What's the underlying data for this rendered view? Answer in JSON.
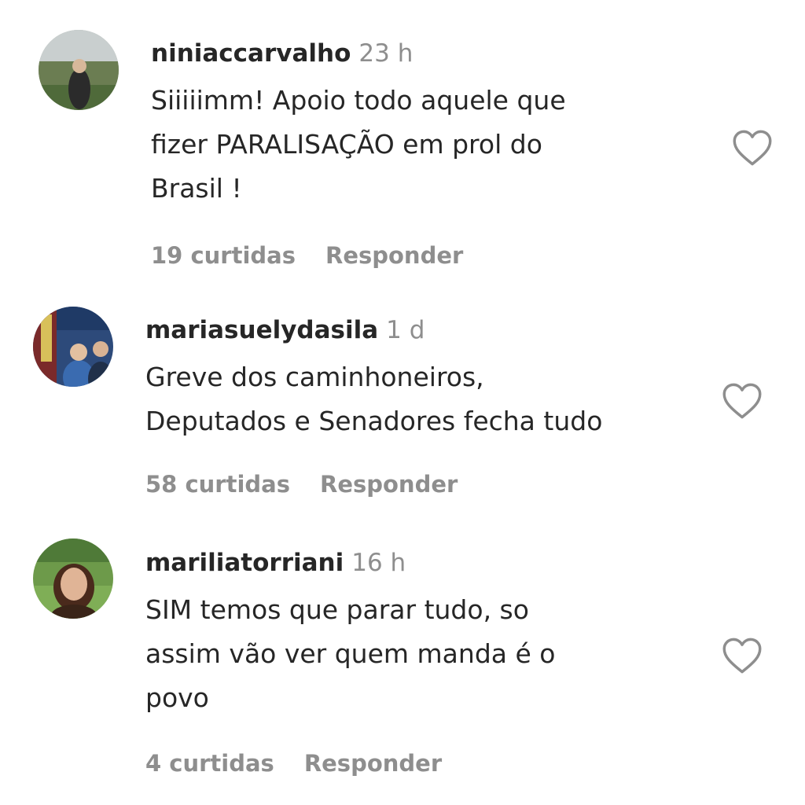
{
  "comments": [
    {
      "username": "niniaccarvalho",
      "time": "23 h",
      "lines": [
        "Siiiiimm! Apoio todo aquele que",
        "fizer PARALISAÇÃO em prol do",
        "Brasil !"
      ],
      "likes": "19 curtidas",
      "reply": "Responder",
      "icon": "heart-outline"
    },
    {
      "username": "mariasuelydasila",
      "time": "1 d",
      "lines": [
        "Greve dos caminhoneiros,",
        "Deputados e Senadores fecha tudo"
      ],
      "likes": "58 curtidas",
      "reply": "Responder",
      "icon": "heart-outline"
    },
    {
      "username": "mariliatorriani",
      "time": "16 h",
      "lines": [
        "SIM temos que parar tudo, so",
        "assim vão ver quem manda é o",
        "povo"
      ],
      "likes": "4 curtidas",
      "reply": "Responder",
      "icon": "heart-outline"
    }
  ],
  "colors": {
    "text": "#262626",
    "secondary": "#8e8e8e",
    "background": "#ffffff"
  }
}
